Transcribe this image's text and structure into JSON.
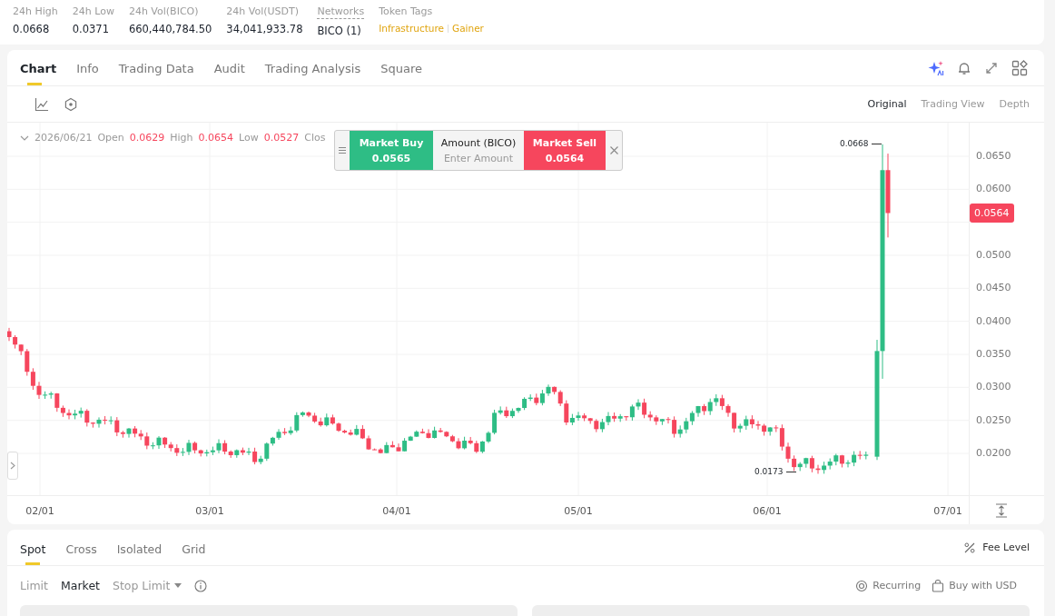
{
  "stats": [
    {
      "kind": "plain",
      "label": "24h High",
      "value": "0.0668"
    },
    {
      "kind": "plain",
      "label": "24h Low",
      "value": "0.0371"
    },
    {
      "kind": "plain",
      "label": "24h Vol(BICO)",
      "value": "660,440,784.50"
    },
    {
      "kind": "plain",
      "label": "24h Vol(USDT)",
      "value": "34,041,933.78"
    },
    {
      "kind": "networks",
      "label": "Networks",
      "value": "BICO (1)"
    },
    {
      "kind": "tags",
      "label": "Token Tags",
      "tags": [
        "Infrastructure",
        "Gainer"
      ]
    }
  ],
  "tabs": [
    {
      "label": "Chart",
      "selected": true
    },
    {
      "label": "Info",
      "selected": false
    },
    {
      "label": "Trading Data",
      "selected": false
    },
    {
      "label": "Audit",
      "selected": false
    },
    {
      "label": "Trading Analysis",
      "selected": false
    },
    {
      "label": "Square",
      "selected": false
    }
  ],
  "views": [
    {
      "label": "Original",
      "selected": true
    },
    {
      "label": "Trading View",
      "selected": false
    },
    {
      "label": "Depth",
      "selected": false
    }
  ],
  "ohlc": {
    "date": "2026/06/21",
    "items": [
      {
        "label": "Open",
        "value": "0.0629"
      },
      {
        "label": "High",
        "value": "0.0654"
      },
      {
        "label": "Low",
        "value": "0.0527"
      },
      {
        "label": "Clos",
        "value": ""
      }
    ]
  },
  "trade_widget": {
    "buy_label": "Market Buy",
    "buy_price": "0.0565",
    "amount_label": "Amount (BICO)",
    "amount_placeholder": "Enter Amount",
    "sell_label": "Market Sell",
    "sell_price": "0.0564"
  },
  "y_axis": [
    "0.0650",
    "0.0600",
    "0.0500",
    "0.0450",
    "0.0400",
    "0.0350",
    "0.0300",
    "0.0250",
    "0.0200"
  ],
  "price_tag": "0.0564",
  "high_marker": "0.0668",
  "low_marker": "0.0173",
  "x_axis": [
    "02/01",
    "03/01",
    "04/01",
    "05/01",
    "06/01",
    "07/01"
  ],
  "order_tabs": [
    {
      "label": "Spot",
      "selected": true
    },
    {
      "label": "Cross",
      "selected": false
    },
    {
      "label": "Isolated",
      "selected": false
    },
    {
      "label": "Grid",
      "selected": false
    }
  ],
  "fee_level": "Fee Level",
  "order_types": [
    {
      "label": "Limit",
      "selected": false,
      "kind": "plain"
    },
    {
      "label": "Market",
      "selected": true,
      "kind": "plain"
    },
    {
      "label": "Stop Limit",
      "selected": false,
      "kind": "dropdown"
    }
  ],
  "right_links": [
    "Recurring",
    "Buy with USD"
  ]
}
